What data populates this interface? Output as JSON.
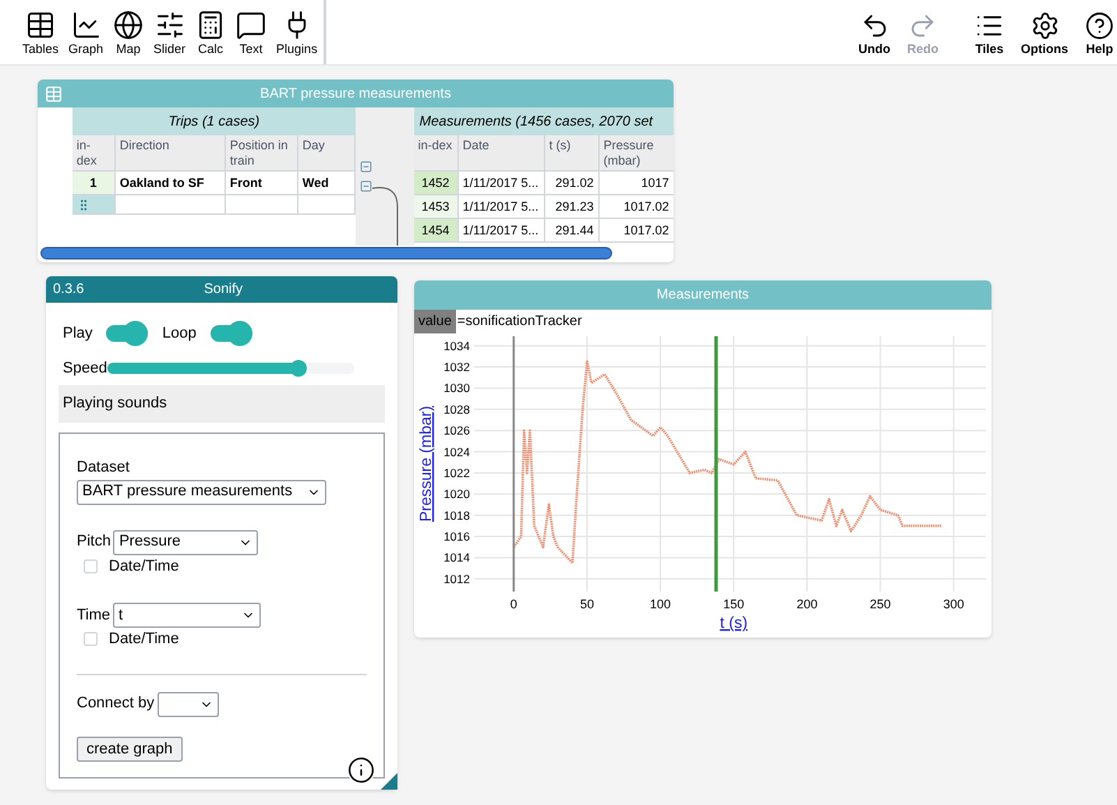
{
  "toolbar": {
    "tools": [
      {
        "kind": "tables",
        "label": "Tables"
      },
      {
        "kind": "graph",
        "label": "Graph"
      },
      {
        "kind": "map",
        "label": "Map"
      },
      {
        "kind": "slider",
        "label": "Slider"
      },
      {
        "kind": "calc",
        "label": "Calc"
      },
      {
        "kind": "text",
        "label": "Text"
      },
      {
        "kind": "plugins",
        "label": "Plugins"
      }
    ],
    "actions": [
      {
        "kind": "undo",
        "label": "Undo",
        "disabled": false
      },
      {
        "kind": "redo",
        "label": "Redo",
        "disabled": true
      },
      {
        "kind": "tiles",
        "label": "Tiles",
        "disabled": false
      },
      {
        "kind": "options",
        "label": "Options",
        "disabled": false
      },
      {
        "kind": "help",
        "label": "Help",
        "disabled": false
      }
    ]
  },
  "table_window": {
    "title": "BART pressure measurements",
    "trips": {
      "title": "Trips (1 cases)",
      "columns": [
        "in-dex",
        "Direction",
        "Position in train",
        "Day"
      ],
      "rows": [
        [
          "1",
          "Oakland to SF",
          "Front",
          "Wed"
        ]
      ]
    },
    "measurements": {
      "title": "Measurements (1456 cases, 2070 set",
      "columns": [
        "in-dex",
        "Date",
        "t (s)",
        "Pressure (mbar)"
      ],
      "rows": [
        [
          "1452",
          "1/11/2017 5...",
          "291.02",
          "1017"
        ],
        [
          "1453",
          "1/11/2017 5...",
          "291.23",
          "1017.02"
        ],
        [
          "1454",
          "1/11/2017 5...",
          "291.44",
          "1017.02"
        ]
      ]
    }
  },
  "sonify": {
    "version": "0.3.6",
    "title": "Sonify",
    "play": {
      "label": "Play",
      "on": true
    },
    "loop": {
      "label": "Loop",
      "on": true
    },
    "speed": {
      "label": "Speed",
      "level": 0.78
    },
    "status": "Playing sounds",
    "dataset": {
      "label": "Dataset",
      "value": "BART pressure measurements"
    },
    "pitch": {
      "label": "Pitch",
      "value": "Pressure",
      "datetime_label": "Date/Time",
      "checked": false
    },
    "time": {
      "label": "Time",
      "value": "t",
      "datetime_label": "Date/Time",
      "checked": false
    },
    "connect_by": {
      "label": "Connect by"
    },
    "button": "create graph"
  },
  "graph_window": {
    "title": "Measurements",
    "attribute_tag": "value",
    "expression": "=sonificationTracker",
    "chart_data": {
      "type": "line",
      "xlabel": "t (s)",
      "ylabel": "Pressure (mbar)",
      "xlim": [
        -27,
        322
      ],
      "ylim": [
        1010.8,
        1034.9
      ],
      "xticks": [
        0,
        50,
        100,
        150,
        200,
        250,
        300
      ],
      "yticks": [
        1012,
        1014,
        1016,
        1018,
        1020,
        1022,
        1024,
        1026,
        1028,
        1030,
        1032,
        1034
      ],
      "x": [
        0,
        5,
        7,
        9,
        11,
        14,
        20,
        24,
        27,
        30,
        40,
        43,
        47,
        50,
        53,
        62,
        70,
        80,
        95,
        100,
        105,
        120,
        130,
        135,
        140,
        150,
        158,
        165,
        180,
        193,
        210,
        215,
        220,
        224,
        230,
        237,
        243,
        250,
        262,
        265,
        280,
        292
      ],
      "grid": true,
      "series": [
        {
          "color": "#f08c6c",
          "line_style": "dotted",
          "values": [
            1015,
            1016,
            1026,
            1022,
            1026,
            1017,
            1015,
            1019,
            1016,
            1015,
            1013.5,
            1020,
            1028,
            1032.5,
            1030.5,
            1031.3,
            1029.5,
            1027,
            1025.5,
            1026.3,
            1025.5,
            1022,
            1022.3,
            1022,
            1023.3,
            1022.8,
            1024,
            1021.5,
            1021.3,
            1018,
            1017.5,
            1019.5,
            1017,
            1018.5,
            1016.5,
            1018,
            1019.8,
            1018.5,
            1018,
            1017,
            1017,
            1017
          ]
        }
      ],
      "ref_lines": [
        {
          "axis": "x",
          "value": 0,
          "color": "#888888"
        },
        {
          "axis": "x",
          "value": 138,
          "color": "#3d9a3d"
        }
      ]
    }
  }
}
